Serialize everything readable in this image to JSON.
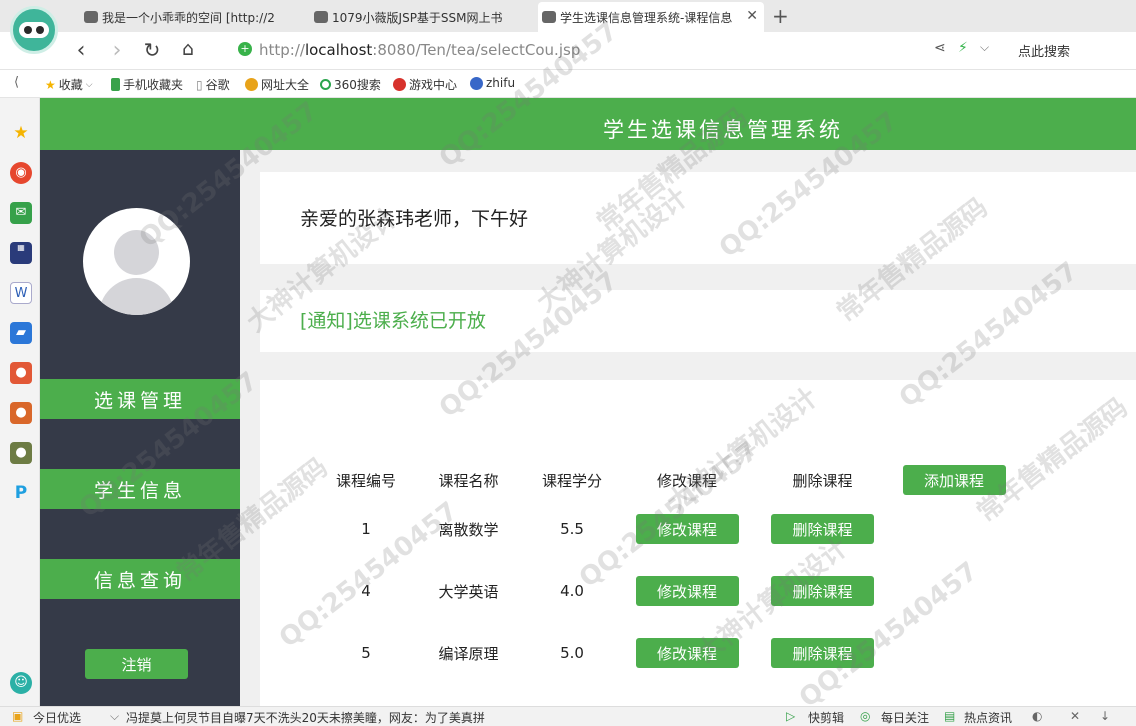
{
  "browser": {
    "tabs": [
      {
        "title": "我是一个小乖乖的空间 [http://2"
      },
      {
        "title": "1079小薇版JSP基于SSM网上书"
      },
      {
        "title": "学生选课信息管理系统-课程信息",
        "active": true
      }
    ],
    "new_tab": "+",
    "close": "✕",
    "url_host": "http://",
    "url_domain": "localhost",
    "url_path": ":8080/Ten/tea/selectCou.jsp",
    "search_hint": "点此搜索",
    "bookmarks": [
      "收藏",
      "手机收藏夹",
      "谷歌",
      "网址大全",
      "360搜索",
      "游戏中心",
      "zhifu"
    ],
    "status": {
      "left": "今日优选",
      "news": "冯提莫上何炅节目自曝7天不洗头20天未擦美瞳，网友：为了美真拼",
      "r1": "快剪辑",
      "r2": "每日关注",
      "r3": "热点资讯"
    }
  },
  "app": {
    "title": "学生选课信息管理系统",
    "menu": [
      "选课管理",
      "学生信息",
      "信息查询"
    ],
    "logout": "注销",
    "greeting": "亲爱的张森玮老师，下午好",
    "notice": "[通知]选课系统已开放",
    "table": {
      "headers": [
        "课程编号",
        "课程名称",
        "课程学分",
        "修改课程",
        "删除课程"
      ],
      "add_button": "添加课程",
      "edit_label": "修改课程",
      "delete_label": "删除课程",
      "rows": [
        {
          "id": "1",
          "name": "离散数学",
          "credit": "5.5"
        },
        {
          "id": "4",
          "name": "大学英语",
          "credit": "4.0"
        },
        {
          "id": "5",
          "name": "编译原理",
          "credit": "5.0"
        }
      ]
    }
  },
  "watermark": [
    "QQ:254540457",
    "大神计算机设计",
    "常年售精品源码"
  ],
  "colors": {
    "accent": "#4cae4c",
    "sidebar": "#353a48"
  }
}
